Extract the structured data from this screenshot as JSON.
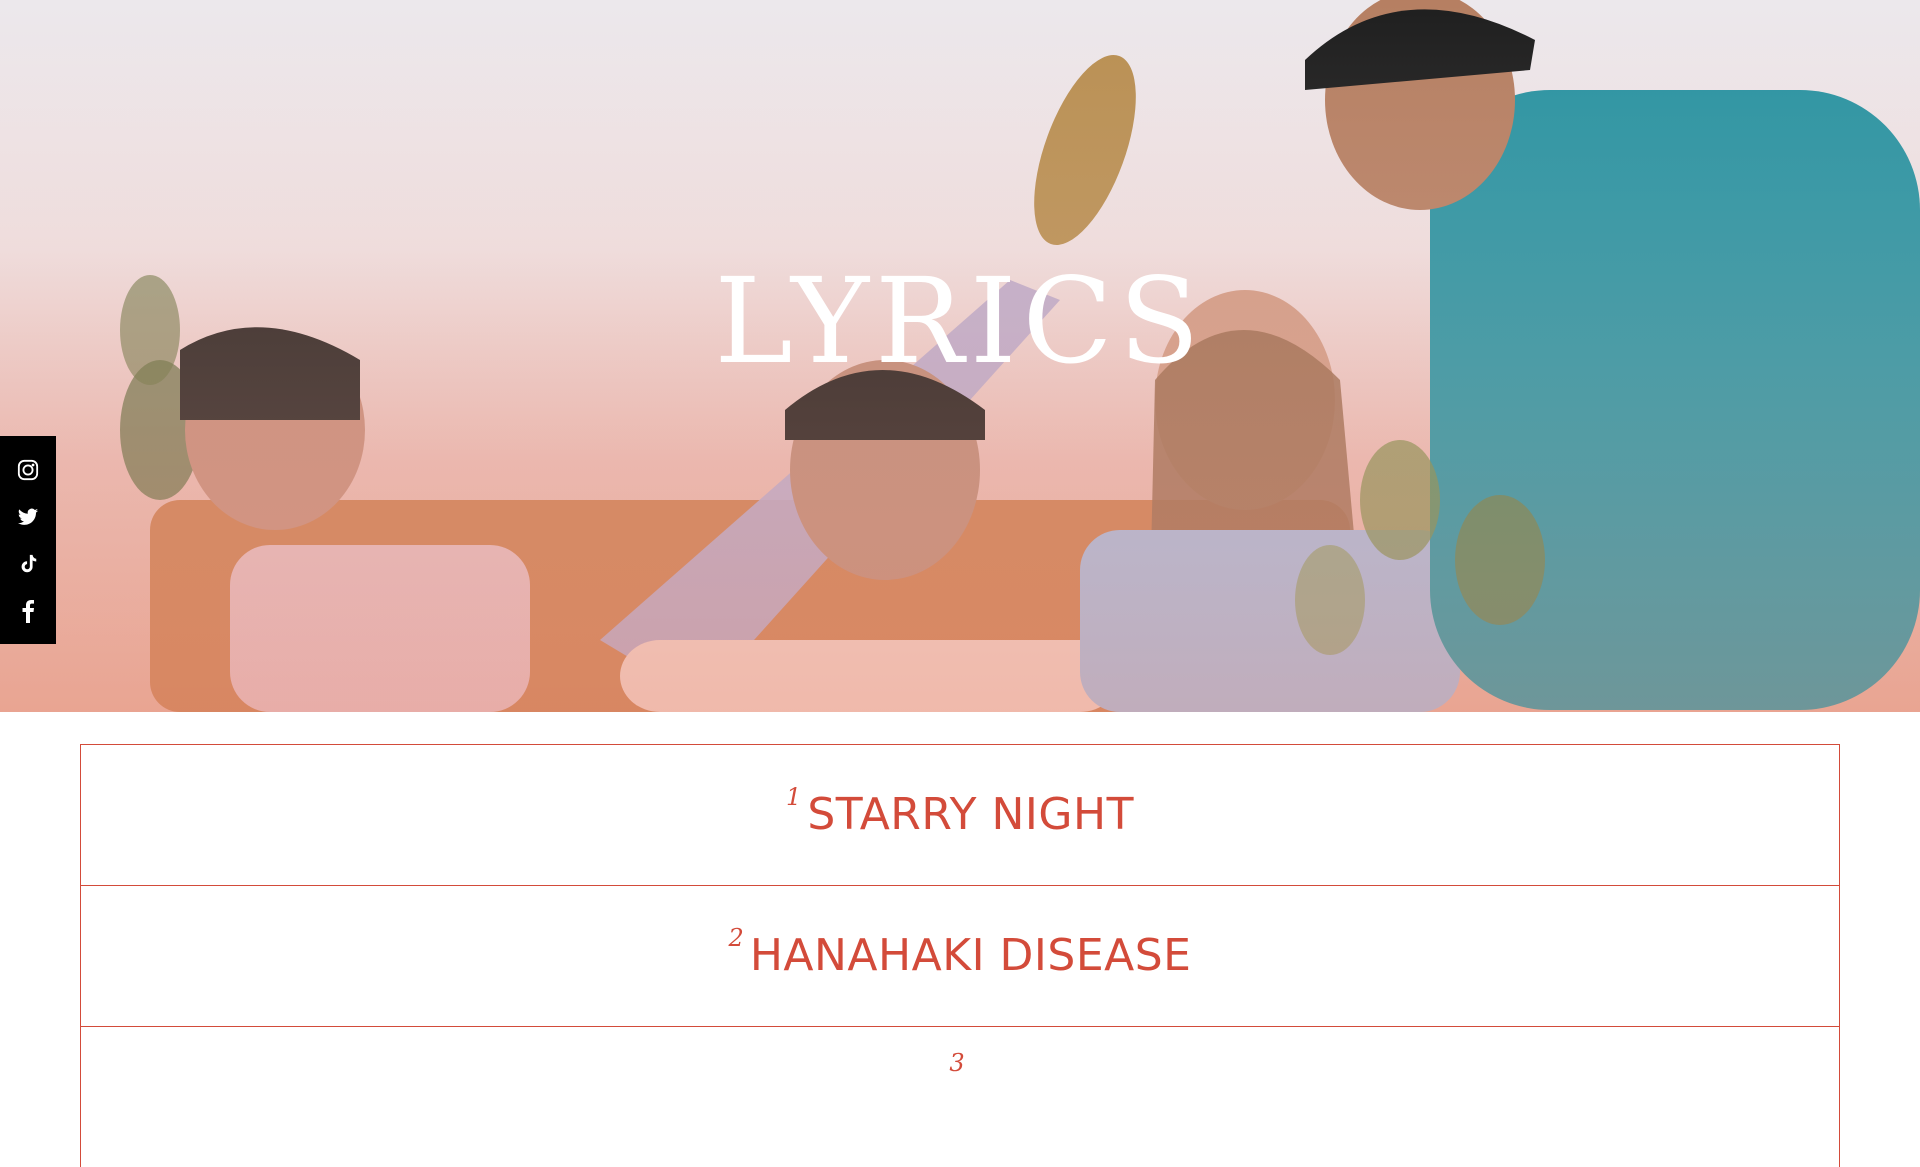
{
  "hero": {
    "title": "LYRICS",
    "image_description_icon": "band-photo"
  },
  "social": [
    {
      "name": "instagram-icon"
    },
    {
      "name": "twitter-icon"
    },
    {
      "name": "tiktok-icon"
    },
    {
      "name": "facebook-icon"
    }
  ],
  "tracks": [
    {
      "number": "1",
      "title": "STARRY NIGHT"
    },
    {
      "number": "2",
      "title": "HANAHAKI DISEASE"
    },
    {
      "number": "3",
      "title": ""
    }
  ],
  "colors": {
    "accent": "#d34b3a",
    "social_bar": "#000000"
  }
}
